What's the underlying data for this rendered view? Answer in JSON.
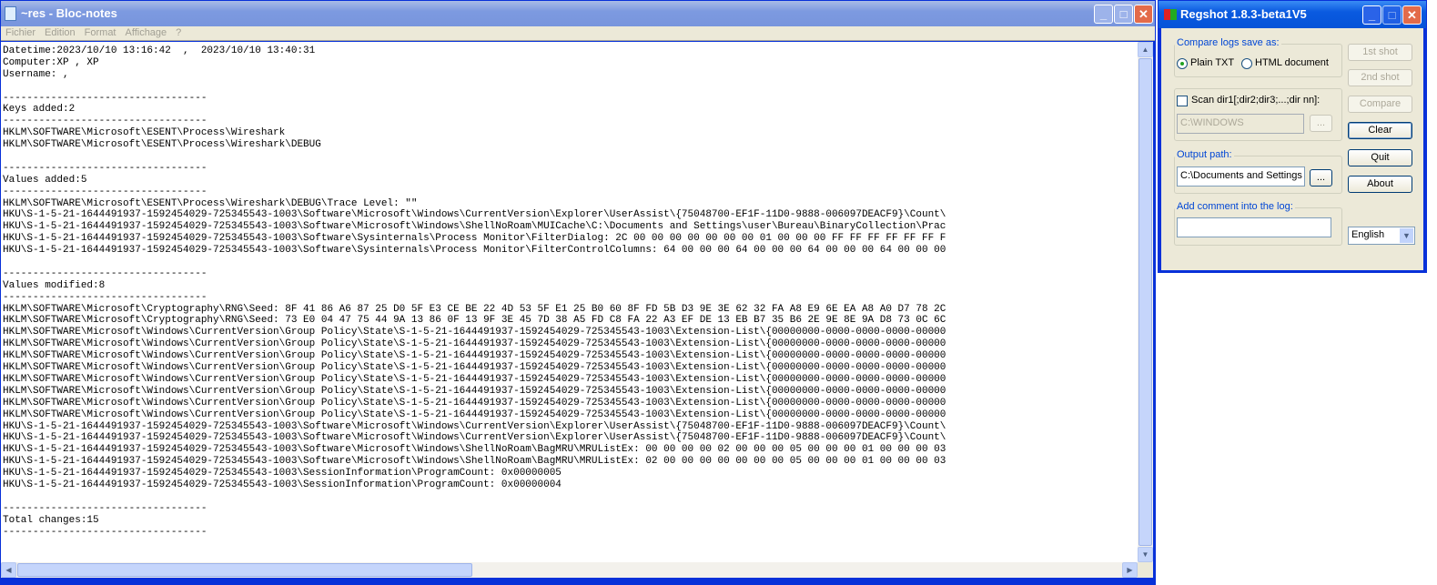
{
  "notepad": {
    "title": "~res - Bloc-notes",
    "menu": [
      "Fichier",
      "Edition",
      "Format",
      "Affichage",
      "?"
    ],
    "lines": [
      "Datetime:2023/10/10 13:16:42  ,  2023/10/10 13:40:31",
      "Computer:XP , XP",
      "Username: ,",
      "",
      "----------------------------------",
      "Keys added:2",
      "----------------------------------",
      "HKLM\\SOFTWARE\\Microsoft\\ESENT\\Process\\Wireshark",
      "HKLM\\SOFTWARE\\Microsoft\\ESENT\\Process\\Wireshark\\DEBUG",
      "",
      "----------------------------------",
      "Values added:5",
      "----------------------------------",
      "HKLM\\SOFTWARE\\Microsoft\\ESENT\\Process\\Wireshark\\DEBUG\\Trace Level: \"\"",
      "HKU\\S-1-5-21-1644491937-1592454029-725345543-1003\\Software\\Microsoft\\Windows\\CurrentVersion\\Explorer\\UserAssist\\{75048700-EF1F-11D0-9888-006097DEACF9}\\Count\\",
      "HKU\\S-1-5-21-1644491937-1592454029-725345543-1003\\Software\\Microsoft\\Windows\\ShellNoRoam\\MUICache\\C:\\Documents and Settings\\user\\Bureau\\BinaryCollection\\Prac",
      "HKU\\S-1-5-21-1644491937-1592454029-725345543-1003\\Software\\Sysinternals\\Process Monitor\\FilterDialog: 2C 00 00 00 00 00 00 00 01 00 00 00 FF FF FF FF FF FF F",
      "HKU\\S-1-5-21-1644491937-1592454029-725345543-1003\\Software\\Sysinternals\\Process Monitor\\FilterControlColumns: 64 00 00 00 64 00 00 00 64 00 00 00 64 00 00 00",
      "",
      "----------------------------------",
      "Values modified:8",
      "----------------------------------",
      "HKLM\\SOFTWARE\\Microsoft\\Cryptography\\RNG\\Seed: 8F 41 86 A6 87 25 D0 5F E3 CE BE 22 4D 53 5F E1 25 B0 60 8F FD 5B D3 9E 3E 62 32 FA A8 E9 6E EA A8 A0 D7 78 2C",
      "HKLM\\SOFTWARE\\Microsoft\\Cryptography\\RNG\\Seed: 73 E0 04 47 75 44 9A 13 86 0F 13 9F 3E 45 7D 38 A5 FD C8 FA 22 A3 EF DE 13 EB B7 35 B6 2E 9E 8E 9A D8 73 0C 6C",
      "HKLM\\SOFTWARE\\Microsoft\\Windows\\CurrentVersion\\Group Policy\\State\\S-1-5-21-1644491937-1592454029-725345543-1003\\Extension-List\\{00000000-0000-0000-0000-00000",
      "HKLM\\SOFTWARE\\Microsoft\\Windows\\CurrentVersion\\Group Policy\\State\\S-1-5-21-1644491937-1592454029-725345543-1003\\Extension-List\\{00000000-0000-0000-0000-00000",
      "HKLM\\SOFTWARE\\Microsoft\\Windows\\CurrentVersion\\Group Policy\\State\\S-1-5-21-1644491937-1592454029-725345543-1003\\Extension-List\\{00000000-0000-0000-0000-00000",
      "HKLM\\SOFTWARE\\Microsoft\\Windows\\CurrentVersion\\Group Policy\\State\\S-1-5-21-1644491937-1592454029-725345543-1003\\Extension-List\\{00000000-0000-0000-0000-00000",
      "HKLM\\SOFTWARE\\Microsoft\\Windows\\CurrentVersion\\Group Policy\\State\\S-1-5-21-1644491937-1592454029-725345543-1003\\Extension-List\\{00000000-0000-0000-0000-00000",
      "HKLM\\SOFTWARE\\Microsoft\\Windows\\CurrentVersion\\Group Policy\\State\\S-1-5-21-1644491937-1592454029-725345543-1003\\Extension-List\\{00000000-0000-0000-0000-00000",
      "HKLM\\SOFTWARE\\Microsoft\\Windows\\CurrentVersion\\Group Policy\\State\\S-1-5-21-1644491937-1592454029-725345543-1003\\Extension-List\\{00000000-0000-0000-0000-00000",
      "HKLM\\SOFTWARE\\Microsoft\\Windows\\CurrentVersion\\Group Policy\\State\\S-1-5-21-1644491937-1592454029-725345543-1003\\Extension-List\\{00000000-0000-0000-0000-00000",
      "HKU\\S-1-5-21-1644491937-1592454029-725345543-1003\\Software\\Microsoft\\Windows\\CurrentVersion\\Explorer\\UserAssist\\{75048700-EF1F-11D0-9888-006097DEACF9}\\Count\\",
      "HKU\\S-1-5-21-1644491937-1592454029-725345543-1003\\Software\\Microsoft\\Windows\\CurrentVersion\\Explorer\\UserAssist\\{75048700-EF1F-11D0-9888-006097DEACF9}\\Count\\",
      "HKU\\S-1-5-21-1644491937-1592454029-725345543-1003\\Software\\Microsoft\\Windows\\ShellNoRoam\\BagMRU\\MRUListEx: 00 00 00 00 02 00 00 00 05 00 00 00 01 00 00 00 03",
      "HKU\\S-1-5-21-1644491937-1592454029-725345543-1003\\Software\\Microsoft\\Windows\\ShellNoRoam\\BagMRU\\MRUListEx: 02 00 00 00 00 00 00 00 05 00 00 00 01 00 00 00 03",
      "HKU\\S-1-5-21-1644491937-1592454029-725345543-1003\\SessionInformation\\ProgramCount: 0x00000005",
      "HKU\\S-1-5-21-1644491937-1592454029-725345543-1003\\SessionInformation\\ProgramCount: 0x00000004",
      "",
      "----------------------------------",
      "Total changes:15",
      "----------------------------------"
    ]
  },
  "regshot": {
    "title": "Regshot 1.8.3-beta1V5",
    "compare_group": "Compare logs save as:",
    "plain_txt": "Plain TXT",
    "html_doc": "HTML document",
    "selected_format": "Plain TXT",
    "scan_dir_label": "Scan dir1[;dir2;dir3;...;dir nn]:",
    "scan_dir_checked": false,
    "scan_dir_value": "C:\\WINDOWS",
    "browse": "...",
    "output_group": "Output path:",
    "output_value": "C:\\Documents and Settings",
    "comment_group": "Add comment into the log:",
    "comment_value": "",
    "buttons": {
      "first_shot": "1st shot",
      "second_shot": "2nd shot",
      "compare": "Compare",
      "clear": "Clear",
      "quit": "Quit",
      "about": "About"
    },
    "language": "English"
  }
}
